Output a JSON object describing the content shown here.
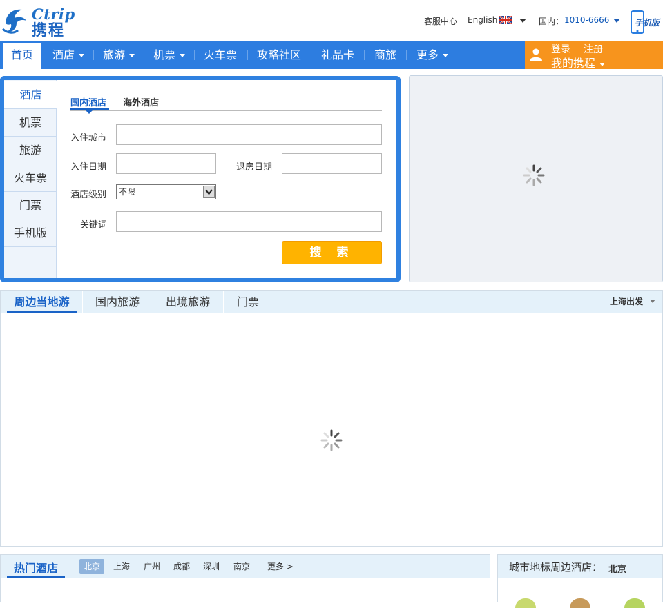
{
  "header": {
    "logo_latin": "Ctrip",
    "logo_cn": "携程",
    "customer_service": "客服中心",
    "language": "English",
    "hotline_label": "国内：",
    "hotline": "1010-6666",
    "mobile_label": "手机版"
  },
  "nav": {
    "items": [
      {
        "label": "首页"
      },
      {
        "label": "酒店"
      },
      {
        "label": "旅游"
      },
      {
        "label": "机票"
      },
      {
        "label": "火车票"
      },
      {
        "label": "攻略社区"
      },
      {
        "label": "礼品卡"
      },
      {
        "label": "商旅"
      },
      {
        "label": "更多"
      }
    ],
    "login": "登录",
    "register": "注册",
    "my_ctrip": "我的携程"
  },
  "search": {
    "side_tabs": [
      "酒店",
      "机票",
      "旅游",
      "火车票",
      "门票",
      "手机版"
    ],
    "sub_tabs": [
      "国内酒店",
      "海外酒店"
    ],
    "city_label": "入住城市",
    "checkin_label": "入住日期",
    "checkout_label": "退房日期",
    "level_label": "酒店级别",
    "level_value": "不限",
    "keyword_label": "关键词",
    "button": "搜 索"
  },
  "tour": {
    "tabs": [
      "周边当地游",
      "国内旅游",
      "出境旅游",
      "门票"
    ],
    "departure": "上海出发"
  },
  "hot_hotels": {
    "title": "热门酒店",
    "cities": [
      "北京",
      "上海",
      "广州",
      "成都",
      "深圳",
      "南京"
    ],
    "more": "更多 >"
  },
  "landmark": {
    "title": "城市地标周边酒店：",
    "city": "北京"
  },
  "colors": {
    "nav_blue": "#2d7de0",
    "user_orange": "#f7941d",
    "search_button": "#ffb300"
  }
}
